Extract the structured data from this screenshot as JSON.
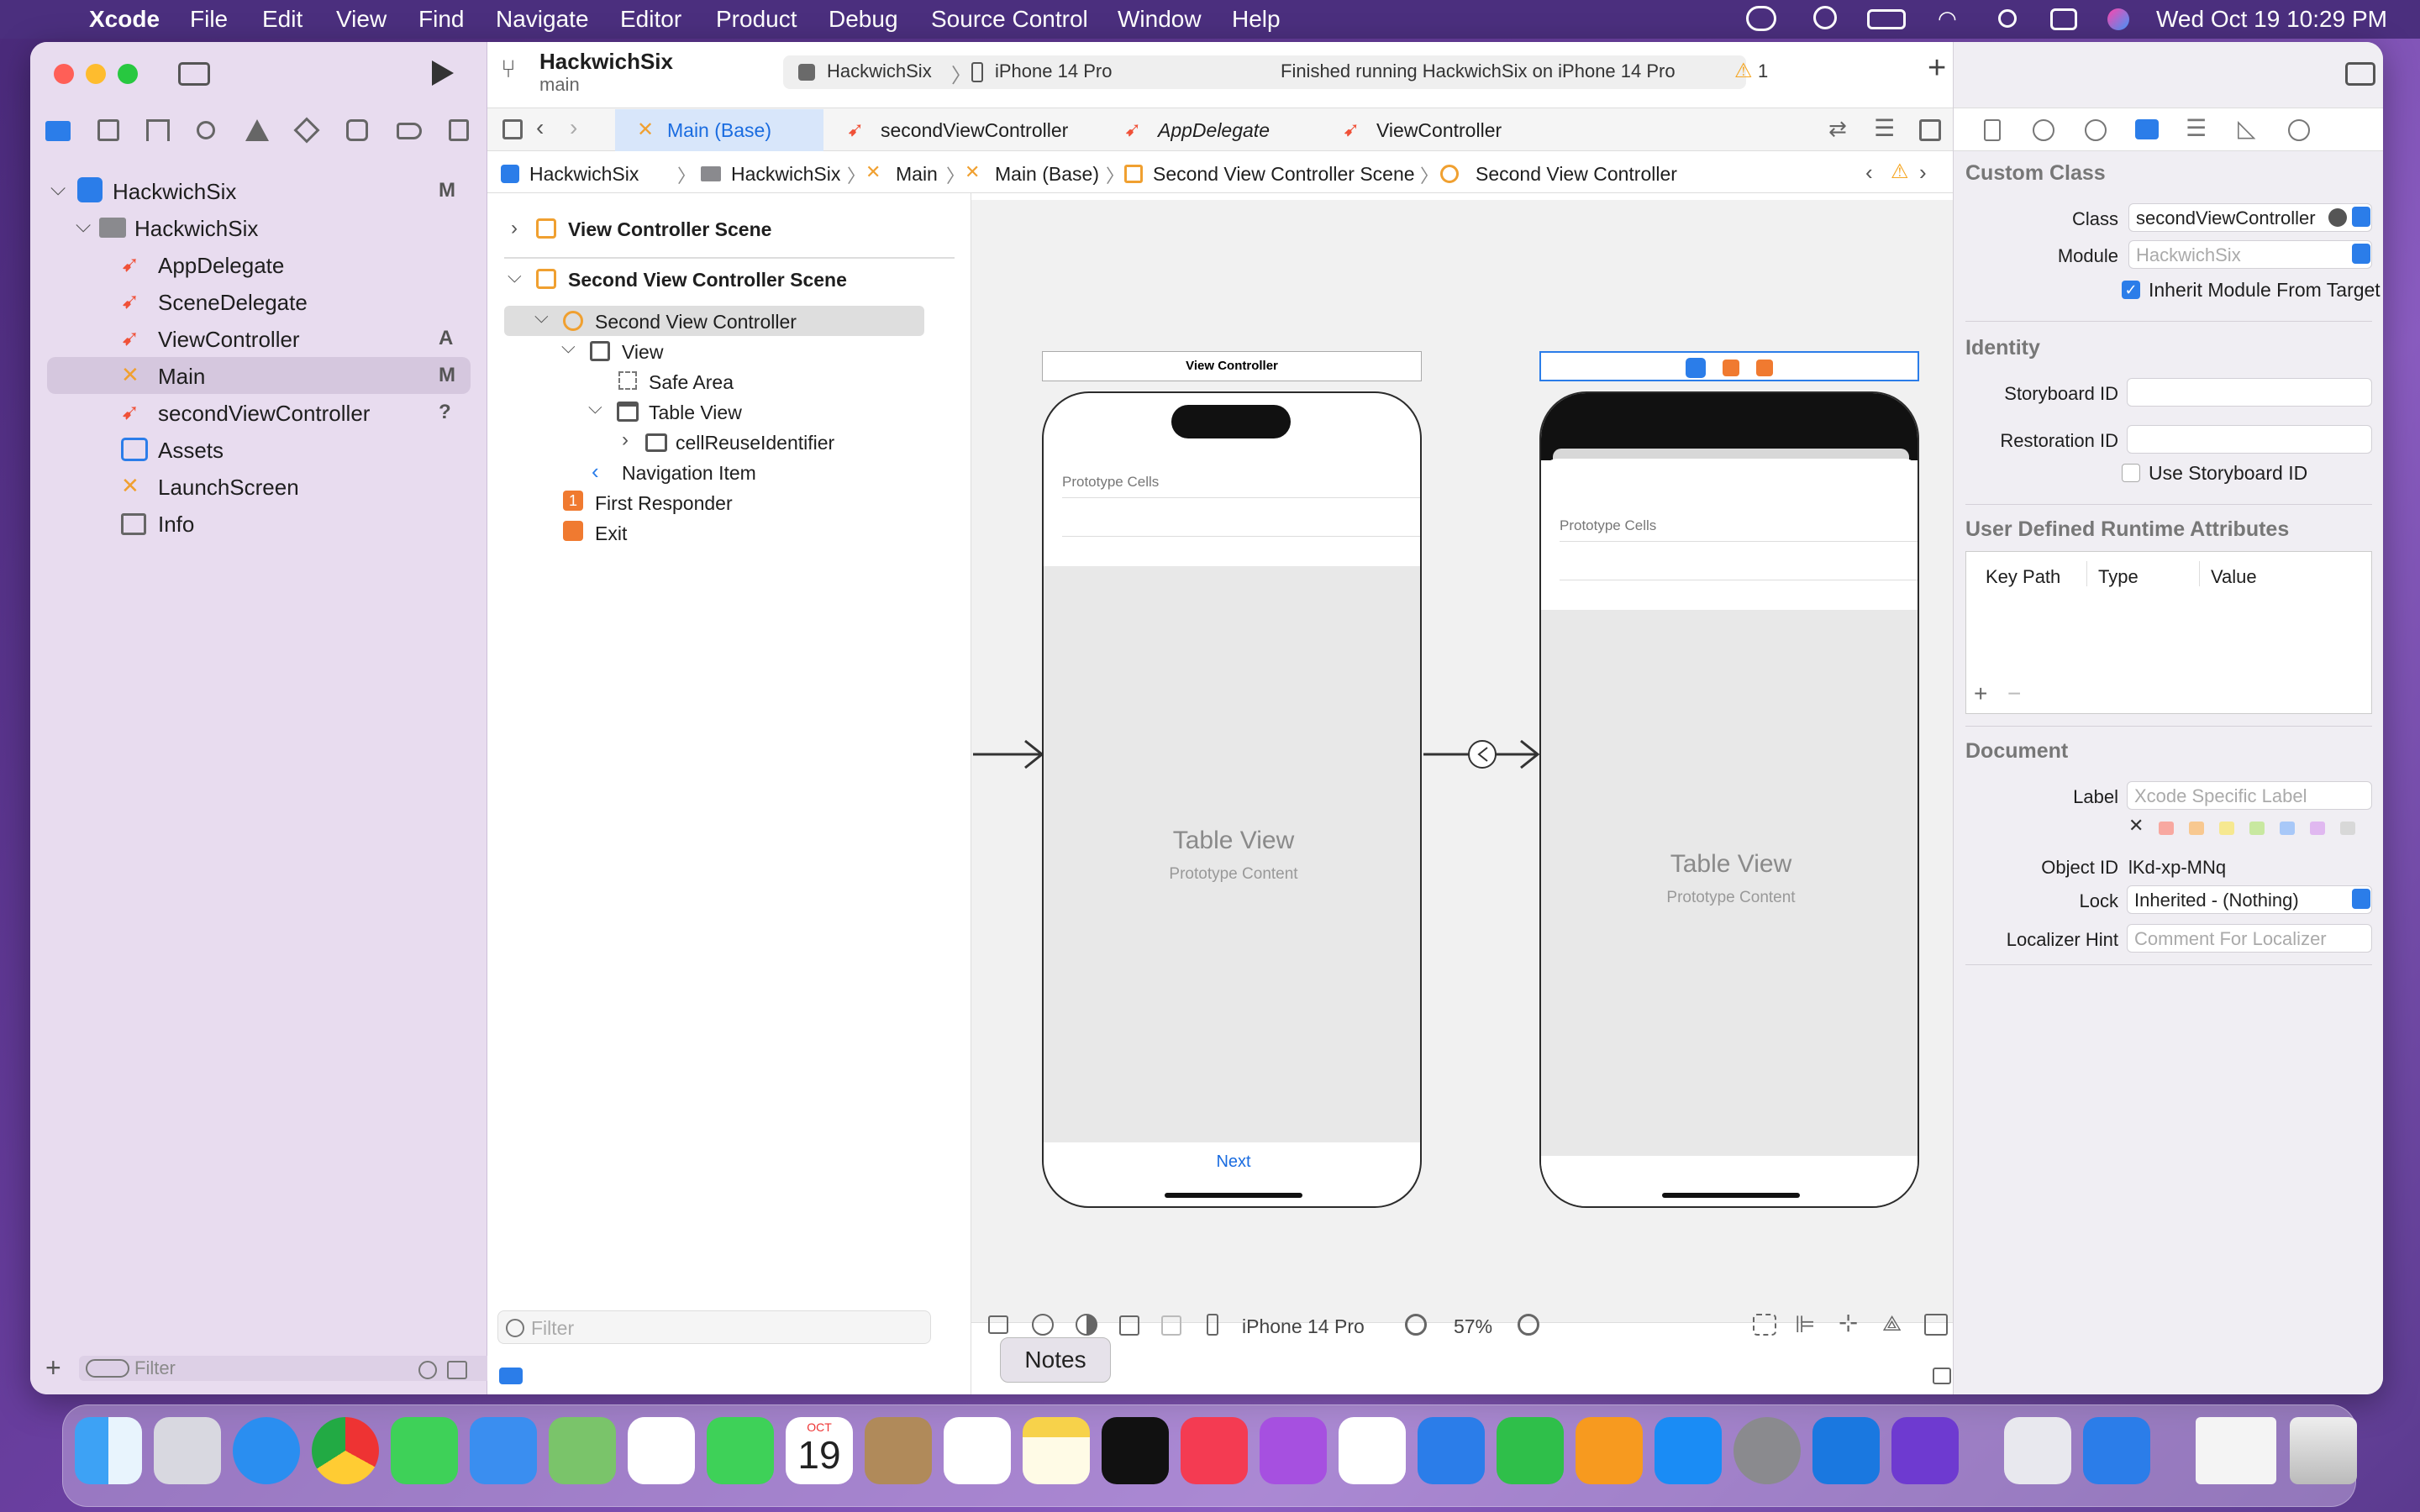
{
  "menubar": {
    "app": "Xcode",
    "menus": [
      "File",
      "Edit",
      "View",
      "Find",
      "Navigate",
      "Editor",
      "Product",
      "Debug",
      "Source Control",
      "Window",
      "Help"
    ],
    "clock": "Wed Oct 19  10:29 PM"
  },
  "toolbar": {
    "project": "HackwichSix",
    "branch": "main",
    "scheme": "HackwichSix",
    "device": "iPhone 14 Pro",
    "status": "Finished running HackwichSix on iPhone 14 Pro",
    "warnings": "1"
  },
  "navigator": {
    "items": [
      {
        "label": "HackwichSix",
        "badge": "M"
      },
      {
        "label": "HackwichSix",
        "badge": ""
      },
      {
        "label": "AppDelegate",
        "badge": ""
      },
      {
        "label": "SceneDelegate",
        "badge": ""
      },
      {
        "label": "ViewController",
        "badge": "A"
      },
      {
        "label": "Main",
        "badge": "M"
      },
      {
        "label": "secondViewController",
        "badge": "?"
      },
      {
        "label": "Assets",
        "badge": ""
      },
      {
        "label": "LaunchScreen",
        "badge": ""
      },
      {
        "label": "Info",
        "badge": ""
      }
    ],
    "filter_placeholder": "Filter"
  },
  "tabs": [
    "Main (Base)",
    "secondViewController",
    "AppDelegate",
    "ViewController"
  ],
  "jumpbar": [
    "HackwichSix",
    "HackwichSix",
    "Main",
    "Main (Base)",
    "Second View Controller Scene",
    "Second View Controller"
  ],
  "outline": {
    "items": [
      "View Controller Scene",
      "Second View Controller Scene",
      "Second View Controller",
      "View",
      "Safe Area",
      "Table View",
      "cellReuseIdentifier",
      "Navigation Item",
      "First Responder",
      "Exit"
    ],
    "filter_placeholder": "Filter"
  },
  "canvas": {
    "vc1_title": "View Controller",
    "proto_cells": "Prototype Cells",
    "table_view": "Table View",
    "proto_content": "Prototype Content",
    "next": "Next",
    "device": "iPhone 14 Pro",
    "zoom": "57%",
    "tooltip": "Notes"
  },
  "inspector": {
    "custom_class": "Custom Class",
    "class_label": "Class",
    "class_value": "secondViewController",
    "module_label": "Module",
    "module_placeholder": "HackwichSix",
    "inherit": "Inherit Module From Target",
    "identity": "Identity",
    "storyboard_id": "Storyboard ID",
    "restoration_id": "Restoration ID",
    "use_storyboard_id": "Use Storyboard ID",
    "udra": "User Defined Runtime Attributes",
    "col_keypath": "Key Path",
    "col_type": "Type",
    "col_value": "Value",
    "document": "Document",
    "label_label": "Label",
    "label_placeholder": "Xcode Specific Label",
    "object_id_label": "Object ID",
    "object_id": "lKd-xp-MNq",
    "lock_label": "Lock",
    "lock_value": "Inherited - (Nothing)",
    "localizer_label": "Localizer Hint",
    "localizer_placeholder": "Comment For Localizer"
  },
  "dock": {
    "calendar_month": "OCT",
    "calendar_day": "19"
  }
}
